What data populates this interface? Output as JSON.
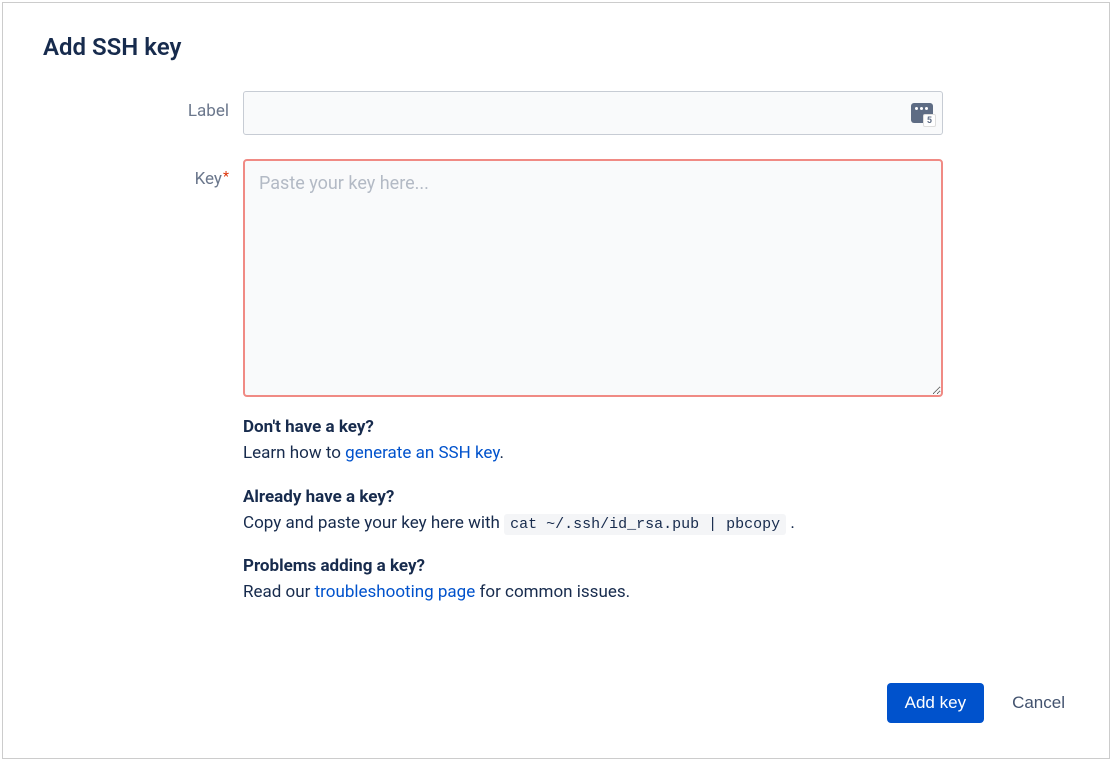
{
  "page": {
    "title": "Add SSH key"
  },
  "form": {
    "label_field": {
      "label": "Label",
      "value": ""
    },
    "key_field": {
      "label": "Key",
      "required_marker": "*",
      "placeholder": "Paste your key here...",
      "value": ""
    }
  },
  "help": {
    "no_key": {
      "heading": "Don't have a key?",
      "prefix": "Learn how to ",
      "link_text": "generate an SSH key",
      "suffix": "."
    },
    "have_key": {
      "heading": "Already have a key?",
      "prefix": "Copy and paste your key here with ",
      "code": "cat ~/.ssh/id_rsa.pub | pbcopy",
      "suffix": " ."
    },
    "problems": {
      "heading": "Problems adding a key?",
      "prefix": "Read our ",
      "link_text": "troubleshooting page",
      "suffix": " for common issues."
    }
  },
  "buttons": {
    "submit": "Add key",
    "cancel": "Cancel"
  }
}
